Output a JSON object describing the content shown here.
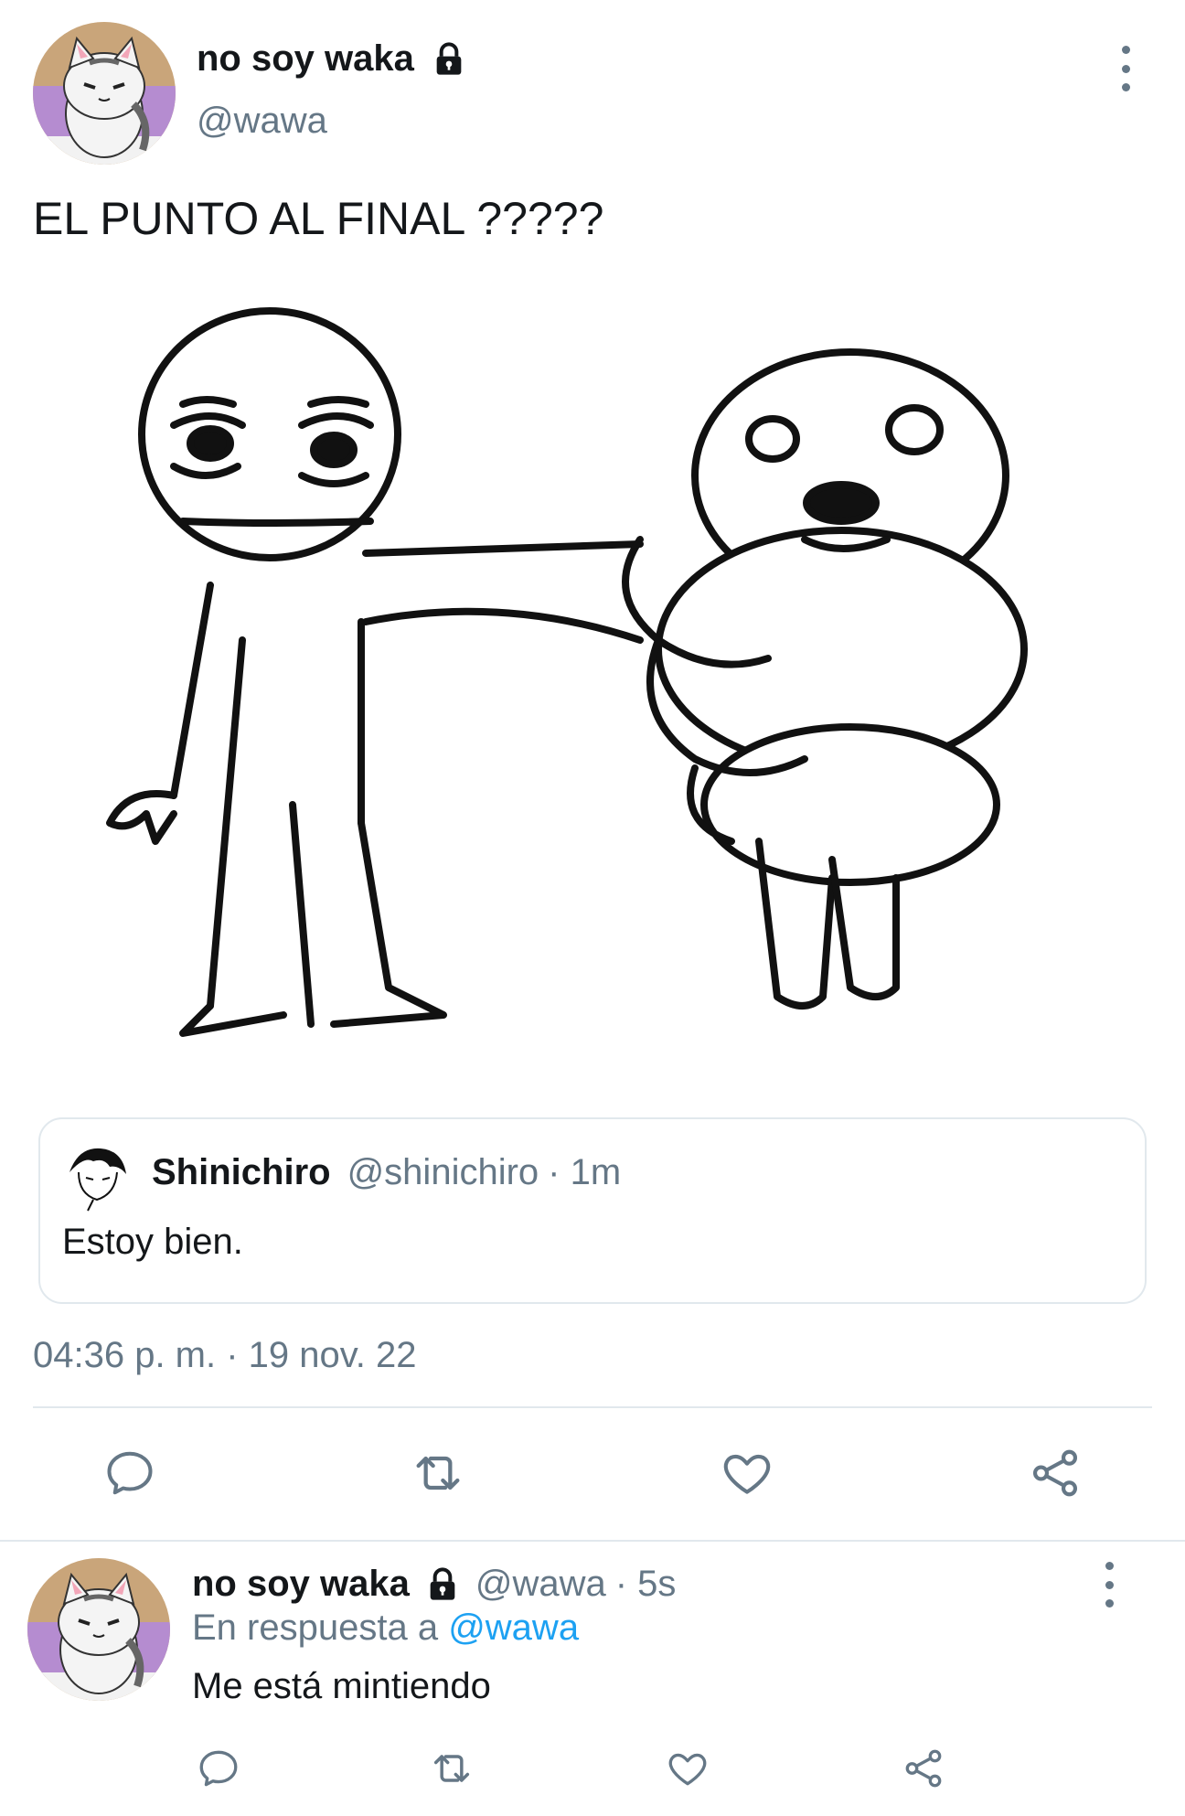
{
  "tweet": {
    "author_name": "no soy waka",
    "author_handle": "@wawa",
    "lock_icon": "lock-icon",
    "text": "EL PUNTO AL FINAL ?????",
    "image": "meme-stickman-holding-creature",
    "timestamp": "04:36 p. m. · 19 nov. 22",
    "quote": {
      "author_name": "Shinichiro",
      "author_handle": "@shinichiro",
      "time": "· 1m",
      "text": "Estoy bien."
    },
    "actions": [
      "reply-icon",
      "retweet-icon",
      "like-icon",
      "share-icon"
    ]
  },
  "reply": {
    "author_name": "no soy waka",
    "author_handle": "@wawa",
    "time": "· 5s",
    "replying_prefix": "En respuesta a",
    "replying_to": "@wawa",
    "text": "Me está mintiendo",
    "actions": [
      "reply-icon",
      "retweet-icon",
      "like-icon",
      "share-icon"
    ]
  },
  "colors": {
    "text": "#14171a",
    "secondary": "#657786",
    "accent": "#1da1f2",
    "divider": "#e1e8ed"
  }
}
